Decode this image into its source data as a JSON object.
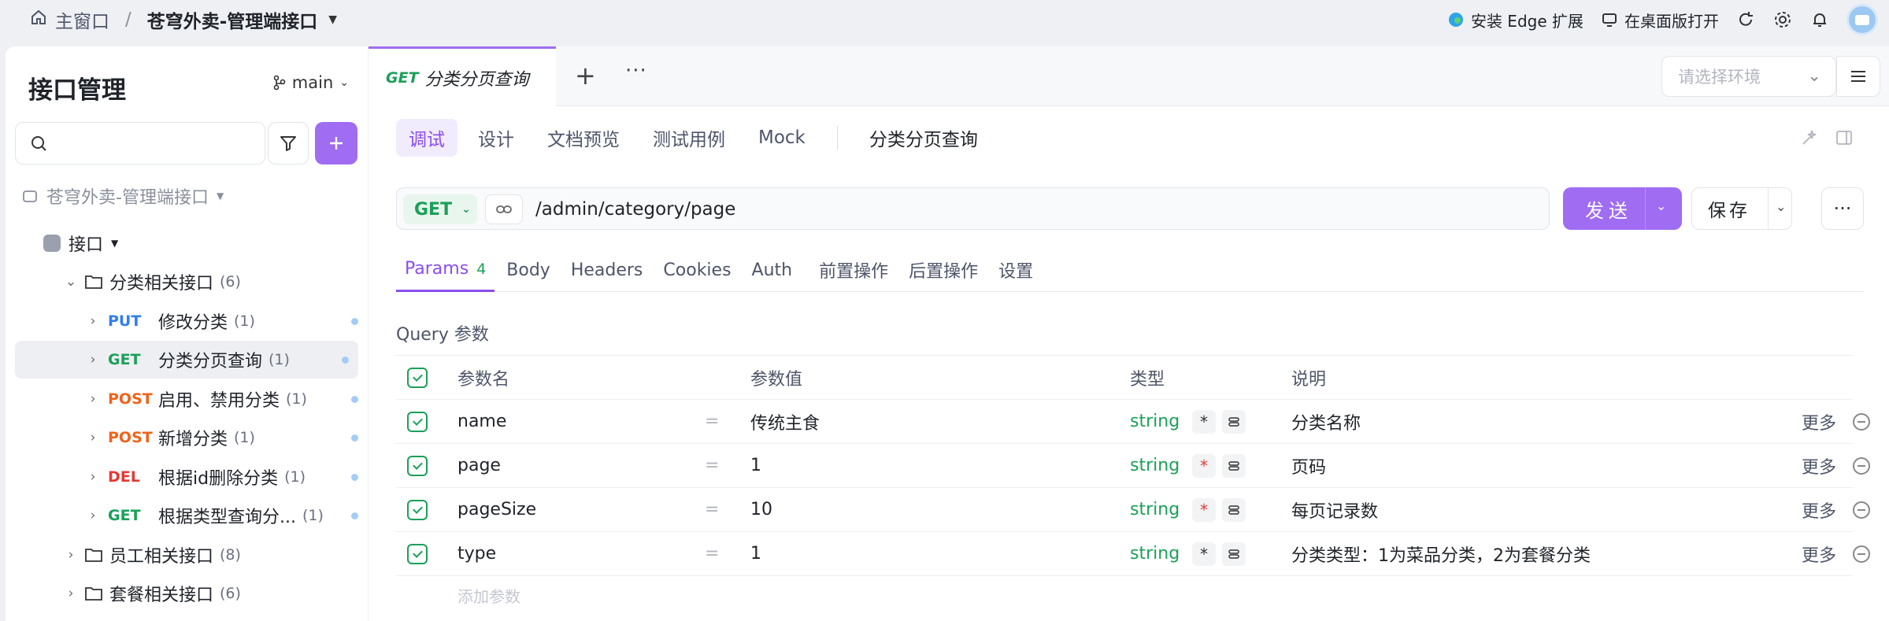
{
  "topbar": {
    "home_label": "主窗口",
    "separator": "/",
    "project": "苍穹外卖-管理端接口",
    "edge_ext": "安装 Edge 扩展",
    "desktop_open": "在桌面版打开"
  },
  "sidebar": {
    "title": "接口管理",
    "branch": "main",
    "search_placeholder": "",
    "project_name": "苍穹外卖-管理端接口",
    "api_root": "接口",
    "folders": [
      {
        "name": "分类相关接口",
        "count": "(6)"
      },
      {
        "name": "员工相关接口",
        "count": "(8)"
      },
      {
        "name": "套餐相关接口",
        "count": "(6)"
      }
    ],
    "endpoints": [
      {
        "method": "PUT",
        "name": "修改分类",
        "count": "(1)"
      },
      {
        "method": "GET",
        "name": "分类分页查询",
        "count": "(1)"
      },
      {
        "method": "POST",
        "name": "启用、禁用分类",
        "count": "(1)"
      },
      {
        "method": "POST",
        "name": "新增分类",
        "count": "(1)"
      },
      {
        "method": "DEL",
        "name": "根据id删除分类",
        "count": "(1)"
      },
      {
        "method": "GET",
        "name": "根据类型查询分...",
        "count": "(1)"
      }
    ]
  },
  "main": {
    "tab": {
      "method": "GET",
      "name": "分类分页查询"
    },
    "env_placeholder": "请选择环境",
    "subtabs": [
      "调试",
      "设计",
      "文档预览",
      "测试用例",
      "Mock"
    ],
    "endpoint_name": "分类分页查询",
    "method": "GET",
    "path": "/admin/category/page",
    "send_label": "发送",
    "save_label": "保存",
    "param_tabs": [
      "Params",
      "Body",
      "Headers",
      "Cookies",
      "Auth",
      "前置操作",
      "后置操作",
      "设置"
    ],
    "params_badge": "4",
    "query_label": "Query 参数",
    "columns": [
      "参数名",
      "参数值",
      "类型",
      "说明"
    ],
    "rows": [
      {
        "name": "name",
        "eq": "=",
        "value": "传统主食",
        "type": "string",
        "req": "*",
        "desc": "分类名称",
        "more": "更多"
      },
      {
        "name": "page",
        "eq": "=",
        "value": "1",
        "type": "string",
        "req": "*",
        "desc": "页码",
        "more": "更多"
      },
      {
        "name": "pageSize",
        "eq": "=",
        "value": "10",
        "type": "string",
        "req": "*",
        "desc": "每页记录数",
        "more": "更多"
      },
      {
        "name": "type",
        "eq": "=",
        "value": "1",
        "type": "string",
        "req": "*",
        "desc": "分类类型：1为菜品分类，2为套餐分类",
        "more": "更多"
      }
    ],
    "add_param": "添加参数"
  }
}
